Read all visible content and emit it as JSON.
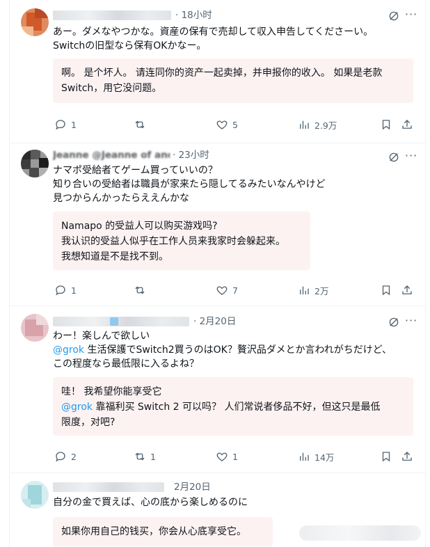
{
  "tweets": [
    {
      "time": "18小时",
      "text_lines": [
        "あー。ダメなやつかな。資産の保有で売却して収入申告してくださーい。",
        "Switchの旧型なら保有OKかなー。"
      ],
      "translation_lines": [
        "啊。 是个坏人。 请连同你的资产一起卖掉，并申报你的收入。 如果是老款",
        "Switch，用它没问题。"
      ],
      "replies": "1",
      "reposts": "",
      "likes": "5",
      "views": "2.9万"
    },
    {
      "name_partial": "Jeanne @Jeanne of and",
      "time": "23小时",
      "text_lines": [
        "ナマポ受給者てゲーム買っていいの？",
        "知り合いの受給者は職員が家来たら隠してるみたいなんやけど",
        "見つからんかったらええんかな"
      ],
      "translation_lines": [
        "Namapo 的受益人可以购买游戏吗?",
        "我认识的受益人似乎在工作人员来我家时会躲起来。",
        "我想知道是不是找不到。"
      ],
      "replies": "1",
      "reposts": "",
      "likes": "7",
      "views": "2万"
    },
    {
      "time": "2月20日",
      "text_lines": [
        "わー！楽しんで欲しい"
      ],
      "mention": "@grok",
      "text_after_mention": " 生活保護でSwitch2買うのはOK？贅沢品ダメとか言われがちだけど、",
      "text_line3": "この程度なら最低限に入るよね？",
      "translation_line1": "哇！ 我希望你能享受它",
      "translation_mention": "@grok",
      "translation_after_mention": " 靠福利买 Switch 2 可以吗？ 人们常说者侈品不好，但这只是最低",
      "translation_line3": "限度，对吧?",
      "replies": "2",
      "reposts": "1",
      "likes": "1",
      "views": "14万"
    },
    {
      "time": "2月20日",
      "text_lines": [
        "自分の金で買えば、心の底から楽しめるのに"
      ],
      "translation_lines": [
        "如果你用自己的钱买，你会从心底享受它。"
      ]
    }
  ],
  "icons": [
    "reply-icon",
    "repost-icon",
    "like-icon",
    "views-icon",
    "bookmark-icon",
    "share-icon",
    "grok-icon",
    "more-icon"
  ],
  "colors": {
    "mention": "#1d9bf0",
    "translation_bg": "#fdf2f2",
    "muted": "#536471",
    "border": "#eff3f4"
  }
}
